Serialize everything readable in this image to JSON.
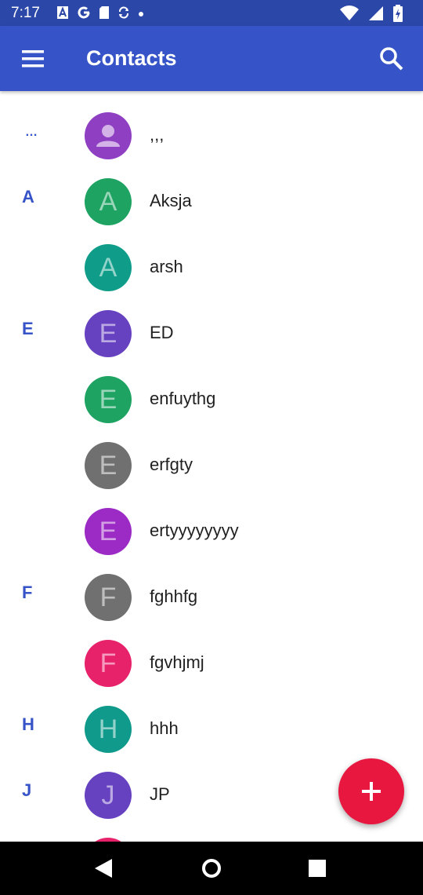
{
  "status_bar": {
    "time": "7:17",
    "left_icons": [
      "notification-a-icon",
      "google-icon",
      "sd-card-icon",
      "sync-icon",
      "dot-icon"
    ],
    "right_icons": [
      "wifi-icon",
      "signal-icon",
      "battery-icon"
    ]
  },
  "app_bar": {
    "title": "Contacts",
    "menu_icon": "hamburger-menu-icon",
    "search_icon": "search-icon",
    "color": "#3654c8",
    "status_color": "#2b47a8"
  },
  "contacts": [
    {
      "section": "…",
      "initial": "",
      "name": ",,,",
      "color": "#8e3fc2",
      "placeholder": true
    },
    {
      "section": "A",
      "initial": "A",
      "name": "Aksja",
      "color": "#1ea362"
    },
    {
      "section": "",
      "initial": "A",
      "name": "arsh",
      "color": "#0f9d8a"
    },
    {
      "section": "E",
      "initial": "E",
      "name": "ED",
      "color": "#6742c0"
    },
    {
      "section": "",
      "initial": "E",
      "name": "enfuythg",
      "color": "#1ea362"
    },
    {
      "section": "",
      "initial": "E",
      "name": "erfgty",
      "color": "#707070"
    },
    {
      "section": "",
      "initial": "E",
      "name": "ertyyyyyyyy",
      "color": "#9b2bc4"
    },
    {
      "section": "F",
      "initial": "F",
      "name": "fghhfg",
      "color": "#707070"
    },
    {
      "section": "",
      "initial": "F",
      "name": "fgvhjmj",
      "color": "#e8216b"
    },
    {
      "section": "H",
      "initial": "H",
      "name": "hhh",
      "color": "#109a8c"
    },
    {
      "section": "J",
      "initial": "J",
      "name": "JP",
      "color": "#6742c0"
    },
    {
      "section": "",
      "initial": "",
      "name": "",
      "color": "#e8216b"
    }
  ],
  "fab": {
    "icon": "plus-icon",
    "color": "#e8173f"
  },
  "nav_bar": {
    "icons": [
      "back-icon",
      "home-icon",
      "recents-icon"
    ]
  }
}
